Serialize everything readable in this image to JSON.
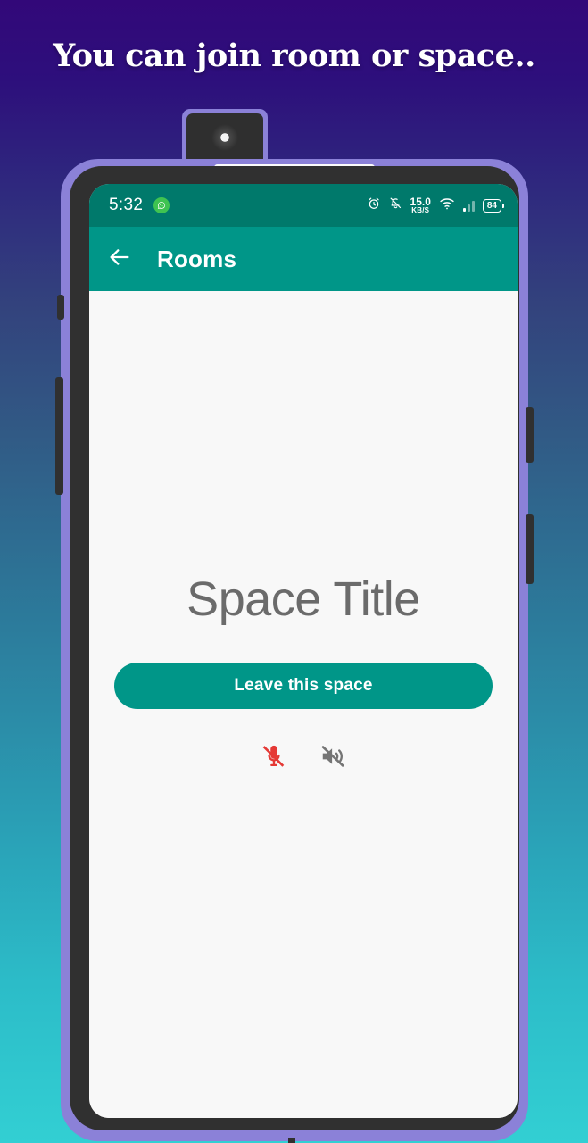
{
  "caption": {
    "text": "You can join room or space.."
  },
  "colors": {
    "gradient_top": "#320879",
    "gradient_bottom": "#32cfd3",
    "frame_purple": "#8b81d8",
    "bezel_dark": "#303030",
    "status_bar": "#00796b",
    "app_bar": "#009688",
    "accent_teal": "#009688",
    "screen_bg": "#f8f8f8",
    "title_gray": "#6b6b6b",
    "mic_muted_red": "#e53935",
    "speaker_muted_gray": "#757575",
    "whatsapp_green": "#3fc351"
  },
  "device": {
    "camera": "popup-camera-module",
    "earpiece": "earpiece-speaker",
    "buttons": [
      "left-small-button",
      "left-volume-rocker",
      "right-button-upper",
      "right-power-button"
    ]
  },
  "status_bar": {
    "time": "5:32",
    "app_icon": "whatsapp-icon",
    "icons": [
      "alarm-icon",
      "notifications-muted-icon",
      "wifi-icon",
      "signal-bars-icon"
    ],
    "net_speed_value": "15.0",
    "net_speed_unit": "KB/S",
    "battery_level": "84"
  },
  "app_bar": {
    "back_icon": "back-arrow-icon",
    "title": "Rooms"
  },
  "main": {
    "space_title": "Space Title",
    "leave_button_label": "Leave this space",
    "controls": [
      {
        "name": "microphone-muted-icon",
        "state": "muted",
        "color": "#e53935"
      },
      {
        "name": "speaker-muted-icon",
        "state": "muted",
        "color": "#757575"
      }
    ]
  }
}
